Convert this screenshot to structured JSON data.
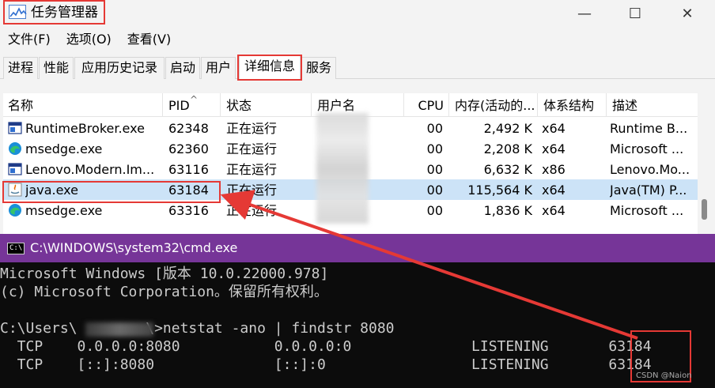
{
  "taskmanager": {
    "title": "任务管理器",
    "window_buttons": {
      "minimize": "—",
      "maximize": "☐",
      "close": "✕"
    },
    "menu": [
      "文件(F)",
      "选项(O)",
      "查看(V)"
    ],
    "tabs": [
      "进程",
      "性能",
      "应用历史记录",
      "启动",
      "用户",
      "详细信息",
      "服务"
    ],
    "active_tab": "详细信息",
    "columns": [
      "名称",
      "PID",
      "状态",
      "用户名",
      "CPU",
      "内存(活动的...",
      "体系结构",
      "描述"
    ],
    "rows": [
      {
        "name": "RuntimeBroker.exe",
        "pid": "62348",
        "status": "正在运行",
        "cpu": "00",
        "memory": "2,492 K",
        "arch": "x64",
        "desc": "Runtime B...",
        "icon": "window-icon"
      },
      {
        "name": "msedge.exe",
        "pid": "62360",
        "status": "正在运行",
        "cpu": "00",
        "memory": "2,208 K",
        "arch": "x64",
        "desc": "Microsoft ...",
        "icon": "edge-icon"
      },
      {
        "name": "Lenovo.Modern.Im...",
        "pid": "63116",
        "status": "正在运行",
        "cpu": "00",
        "memory": "6,632 K",
        "arch": "x86",
        "desc": "Lenovo.Mo...",
        "icon": "window-icon"
      },
      {
        "name": "java.exe",
        "pid": "63184",
        "status": "正在运行",
        "cpu": "00",
        "memory": "115,564 K",
        "arch": "x64",
        "desc": "Java(TM) P...",
        "icon": "java-icon",
        "selected": true
      },
      {
        "name": "msedge.exe",
        "pid": "63316",
        "status": "正在运行",
        "cpu": "00",
        "memory": "1,836 K",
        "arch": "x64",
        "desc": "Microsoft ...",
        "icon": "edge-icon"
      }
    ]
  },
  "cmd": {
    "title": "C:\\WINDOWS\\system32\\cmd.exe",
    "icon_text": "C:\\",
    "lines": [
      "Microsoft Windows [版本 10.0.22000.978]",
      "(c) Microsoft Corporation。保留所有权利。",
      "",
      "C:\\Users\\        \\>netstat -ano | findstr 8080",
      "  TCP    0.0.0.0:8080           0.0.0.0:0              LISTENING       63184",
      "  TCP    [::]:8080              [::]:0                 LISTENING       63184"
    ]
  },
  "watermark": "CSDN @Naion",
  "colors": {
    "highlight": "#e53935",
    "cmd_title": "#763598",
    "selected_row": "#cce3f7"
  }
}
